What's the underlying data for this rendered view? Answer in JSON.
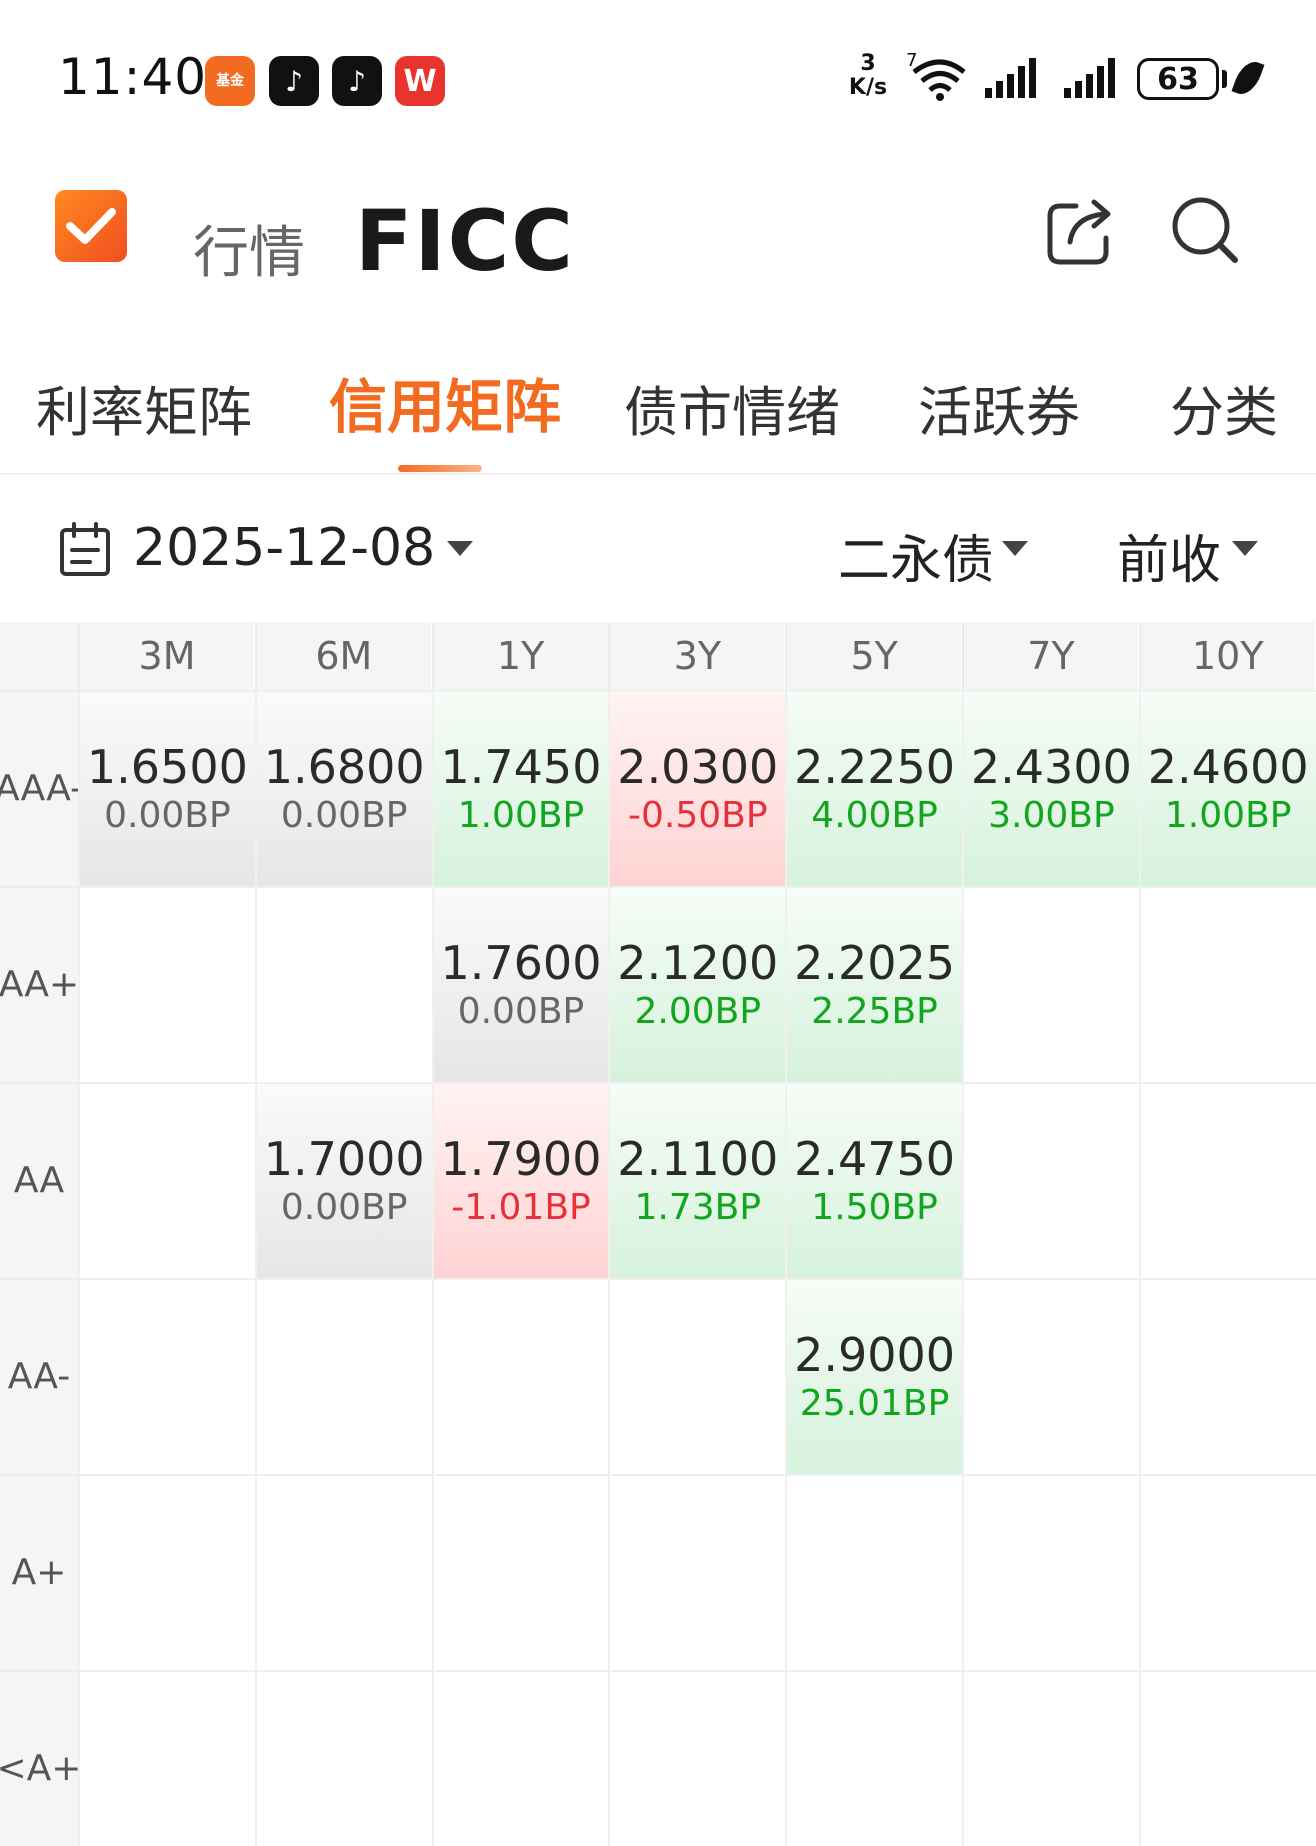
{
  "status_bar": {
    "time": "11:40",
    "apps": [
      {
        "name": "fund-app-icon",
        "label": "基金"
      },
      {
        "name": "tiktok-icon",
        "label": "♪"
      },
      {
        "name": "tiktok-icon-2",
        "label": "♪"
      },
      {
        "name": "wps-icon",
        "label": "W"
      }
    ],
    "speed_value": "3",
    "speed_unit": "K/s",
    "wifi_badge": "7",
    "battery": "63"
  },
  "header": {
    "section": "行情",
    "title": "FICC"
  },
  "tabs": [
    {
      "label": "利率矩阵",
      "active": false
    },
    {
      "label": "信用矩阵",
      "active": true
    },
    {
      "label": "债市情绪",
      "active": false
    },
    {
      "label": "活跃券",
      "active": false
    },
    {
      "label": "分类",
      "active": false
    }
  ],
  "filters": {
    "date": "2025-12-08",
    "bond_type": "二永债",
    "price_basis": "前收"
  },
  "matrix": {
    "columns": [
      "3M",
      "6M",
      "1Y",
      "3Y",
      "5Y",
      "7Y",
      "10Y"
    ],
    "rows": [
      {
        "rating": "AAA-",
        "cells": [
          {
            "rate": "1.6500",
            "chg": "0.00BP",
            "dir": "flat"
          },
          {
            "rate": "1.6800",
            "chg": "0.00BP",
            "dir": "flat"
          },
          {
            "rate": "1.7450",
            "chg": "1.00BP",
            "dir": "up"
          },
          {
            "rate": "2.0300",
            "chg": "-0.50BP",
            "dir": "down"
          },
          {
            "rate": "2.2250",
            "chg": "4.00BP",
            "dir": "up"
          },
          {
            "rate": "2.4300",
            "chg": "3.00BP",
            "dir": "up"
          },
          {
            "rate": "2.4600",
            "chg": "1.00BP",
            "dir": "up"
          }
        ]
      },
      {
        "rating": "AA+",
        "cells": [
          null,
          null,
          {
            "rate": "1.7600",
            "chg": "0.00BP",
            "dir": "flat"
          },
          {
            "rate": "2.1200",
            "chg": "2.00BP",
            "dir": "up"
          },
          {
            "rate": "2.2025",
            "chg": "2.25BP",
            "dir": "up"
          },
          null,
          null
        ]
      },
      {
        "rating": "AA",
        "cells": [
          null,
          {
            "rate": "1.7000",
            "chg": "0.00BP",
            "dir": "flat"
          },
          {
            "rate": "1.7900",
            "chg": "-1.01BP",
            "dir": "down"
          },
          {
            "rate": "2.1100",
            "chg": "1.73BP",
            "dir": "up"
          },
          {
            "rate": "2.4750",
            "chg": "1.50BP",
            "dir": "up"
          },
          null,
          null
        ]
      },
      {
        "rating": "AA-",
        "cells": [
          null,
          null,
          null,
          null,
          {
            "rate": "2.9000",
            "chg": "25.01BP",
            "dir": "up"
          },
          null,
          null
        ]
      },
      {
        "rating": "A+",
        "cells": [
          null,
          null,
          null,
          null,
          null,
          null,
          null
        ]
      },
      {
        "rating": "<A+",
        "cells": [
          null,
          null,
          null,
          null,
          null,
          null,
          null
        ]
      }
    ]
  },
  "colors": {
    "accent": "#f26b21",
    "up": "#12a51e",
    "down": "#e8303a",
    "flat": "#666666"
  }
}
